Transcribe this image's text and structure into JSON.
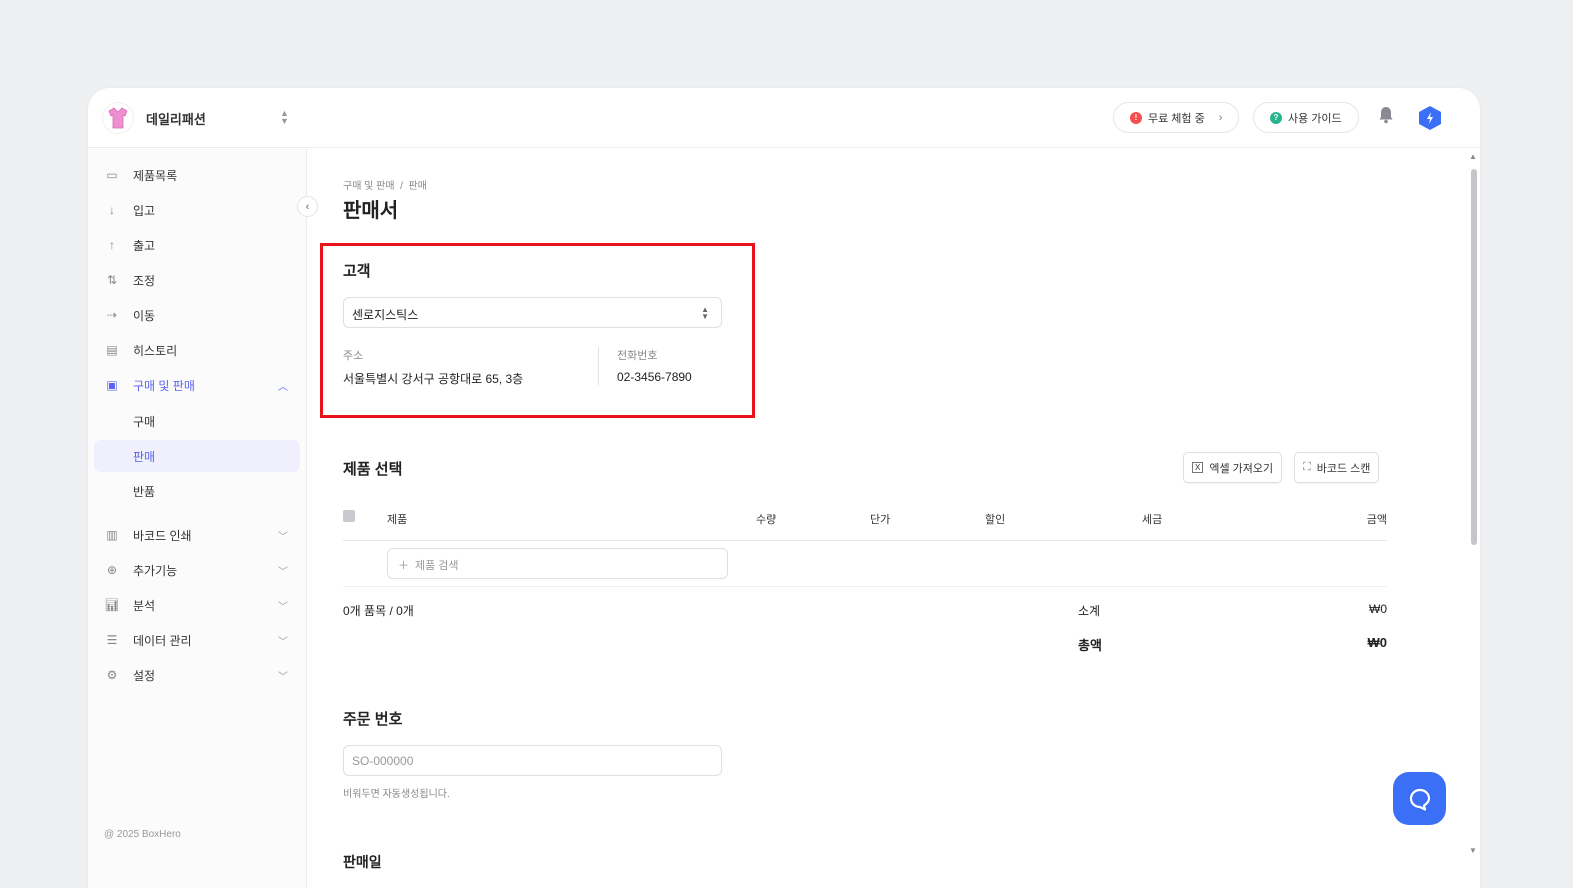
{
  "header": {
    "company": "데일리패션",
    "trial_label": "무료 체험 중",
    "guide_label": "사용 가이드",
    "colors": {
      "trial_dot": "#f44e4e",
      "guide_dot": "#27b48f",
      "brand": "#3b6ff5"
    }
  },
  "sidebar": {
    "items": [
      {
        "label": "제품목록",
        "icon": "box-icon"
      },
      {
        "label": "입고",
        "icon": "arrow-down-icon"
      },
      {
        "label": "출고",
        "icon": "arrow-up-icon"
      },
      {
        "label": "조정",
        "icon": "swap-icon"
      },
      {
        "label": "이동",
        "icon": "arrow-right-icon"
      },
      {
        "label": "히스토리",
        "icon": "history-icon"
      },
      {
        "label": "구매 및 판매",
        "icon": "document-icon"
      },
      {
        "label": "구매"
      },
      {
        "label": "판매"
      },
      {
        "label": "반품"
      },
      {
        "label": "바코드 인쇄",
        "icon": "barcode-icon"
      },
      {
        "label": "추가기능",
        "icon": "plus-circle-icon"
      },
      {
        "label": "분석",
        "icon": "chart-icon"
      },
      {
        "label": "데이터 관리",
        "icon": "database-icon"
      },
      {
        "label": "설정",
        "icon": "gear-icon"
      }
    ],
    "copyright": "@ 2025 BoxHero"
  },
  "main": {
    "breadcrumb": "구매 및 판매  /  판매",
    "title": "판매서",
    "customer": {
      "heading": "고객",
      "selected": "센로지스틱스",
      "address_label": "주소",
      "address": "서울특별시 강서구 공항대로 65, 3층",
      "phone_label": "전화번호",
      "phone": "02-3456-7890"
    },
    "products": {
      "heading": "제품 선택",
      "excel_button": "엑셀 가져오기",
      "barcode_button": "바코드 스캔",
      "columns": [
        "제품",
        "수량",
        "단가",
        "할인",
        "세금",
        "금액"
      ],
      "search_placeholder": "제품 검색",
      "count": "0개 품목 / 0개",
      "subtotal_label": "소계",
      "subtotal": "₩0",
      "total_label": "총액",
      "total": "₩0"
    },
    "order": {
      "heading": "주문 번호",
      "placeholder": "SO-000000",
      "hint": "비워두면 자동생성됩니다."
    },
    "next_heading": "판매일"
  }
}
